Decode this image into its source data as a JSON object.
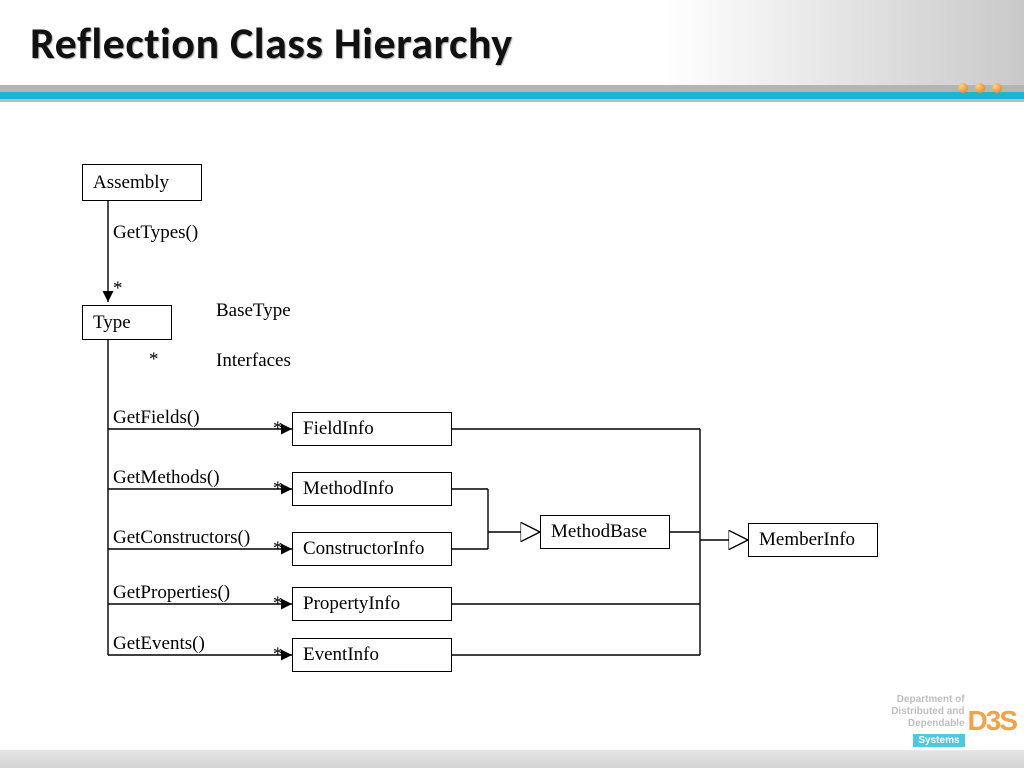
{
  "slide": {
    "title": "Reflection Class Hierarchy"
  },
  "logo": {
    "line1": "Department of",
    "line2": "Distributed and",
    "line3": "Dependable",
    "systems": "Systems",
    "mark": "D3S"
  },
  "boxes": {
    "assembly": "Assembly",
    "type": "Type",
    "fieldinfo": "FieldInfo",
    "methodinfo": "MethodInfo",
    "constructorinfo": "ConstructorInfo",
    "propertyinfo": "PropertyInfo",
    "eventinfo": "EventInfo",
    "methodbase": "MethodBase",
    "memberinfo": "MemberInfo"
  },
  "labels": {
    "gettypes": "GetTypes()",
    "basetype": "BaseType",
    "interfaces": "Interfaces",
    "getfields": "GetFields()",
    "getmethods": "GetMethods()",
    "getconstructors": "GetConstructors()",
    "getproperties": "GetProperties()",
    "getevents": "GetEvents()"
  },
  "multiplicity": "*"
}
